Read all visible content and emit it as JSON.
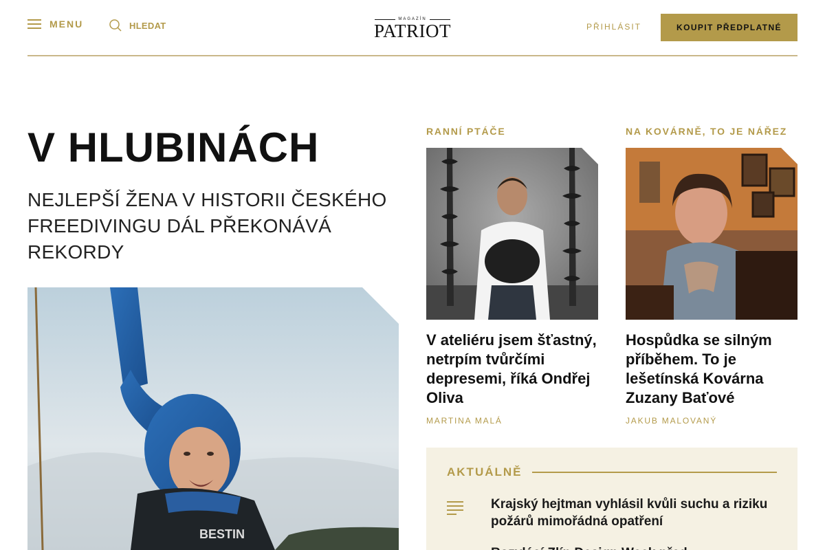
{
  "header": {
    "menu_label": "MENU",
    "search_label": "HLEDAT",
    "logo_small": "MAGAZÍN",
    "logo_big": "PATRIOT",
    "login_label": "PŘIHLÁSIT",
    "subscribe_label": "KOUPIT PŘEDPLATNÉ"
  },
  "main_article": {
    "title": "V HLUBINÁCH",
    "subtitle": "NEJLEPŠÍ ŽENA V HISTORII ČESKÉHO FREEDIVINGU DÁL PŘEKONÁVÁ REKORDY"
  },
  "cards": [
    {
      "category": "RANNÍ PTÁČE",
      "title": "V ateliéru jsem šťastný, netrpím tvůrčími depresemi, říká Ondřej Oliva",
      "author": "MARTINA MALÁ"
    },
    {
      "category": "NA KOVÁRNĚ, TO JE NÁŘEZ",
      "title": "Hospůdka se silným příběhem. To je lešetínská Kovárna Zuzany Baťové",
      "author": "JAKUB MALOVANÝ"
    }
  ],
  "news": {
    "heading": "AKTUÁLNĚ",
    "items": [
      {
        "title": "Krajský hejtman vyhlásil kvůli suchu a riziku požárů mimořádná opatření"
      },
      {
        "title": "Rozvlácí Zlín Design Week před..."
      }
    ]
  },
  "colors": {
    "accent": "#b39a4a",
    "news_bg": "#f5f1e3",
    "text": "#111111"
  }
}
